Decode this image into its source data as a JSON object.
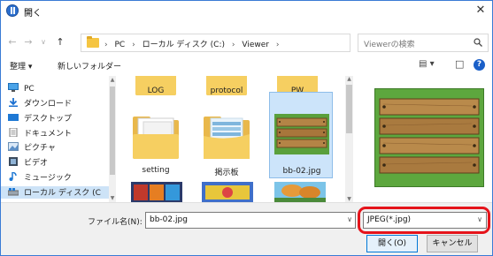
{
  "window": {
    "title": "開く",
    "close_glyph": "✕"
  },
  "nav": {
    "back_glyph": "←",
    "forward_glyph": "→",
    "recent_glyph": "∨",
    "up_glyph": "↑"
  },
  "address": {
    "crumbs": [
      "PC",
      "ローカル ディスク (C:)",
      "Viewer"
    ],
    "separator": "›",
    "dropdown_glyph": "∨",
    "refresh_glyph": "↻"
  },
  "search": {
    "placeholder": "Viewerの検索"
  },
  "toolbar": {
    "organize_label": "整理 ▾",
    "new_folder_label": "新しいフォルダー",
    "view_glyph": "▤ ▾",
    "pane_glyph": "□",
    "help_glyph": "?"
  },
  "sidebar": {
    "items": [
      {
        "label": "PC",
        "icon": "pc-icon"
      },
      {
        "label": "ダウンロード",
        "icon": "download-icon"
      },
      {
        "label": "デスクトップ",
        "icon": "desktop-icon"
      },
      {
        "label": "ドキュメント",
        "icon": "documents-icon"
      },
      {
        "label": "ピクチャ",
        "icon": "pictures-icon"
      },
      {
        "label": "ビデオ",
        "icon": "video-icon"
      },
      {
        "label": "ミュージック",
        "icon": "music-icon"
      },
      {
        "label": "ローカル ディスク (C",
        "icon": "disk-icon"
      }
    ]
  },
  "files": {
    "items": [
      {
        "label": "LOG",
        "type": "folder"
      },
      {
        "label": "protocol",
        "type": "folder"
      },
      {
        "label": "PW",
        "type": "folder"
      },
      {
        "label": "setting",
        "type": "folder"
      },
      {
        "label": "掲示板",
        "type": "folder"
      },
      {
        "label": "bb-02.jpg",
        "type": "image",
        "selected": true
      }
    ]
  },
  "bottom": {
    "filename_label": "ファイル名(N):",
    "filename_value": "bb-02.jpg",
    "filetype_value": "JPEG(*.jpg)",
    "dropdown_glyph": "∨",
    "open_label": "開く(O)",
    "cancel_label": "キャンセル"
  },
  "colors": {
    "accent": "#0078d7",
    "highlight_ring": "#e5141b",
    "folder": "#f6cf61",
    "selection": "#cce4fa"
  }
}
